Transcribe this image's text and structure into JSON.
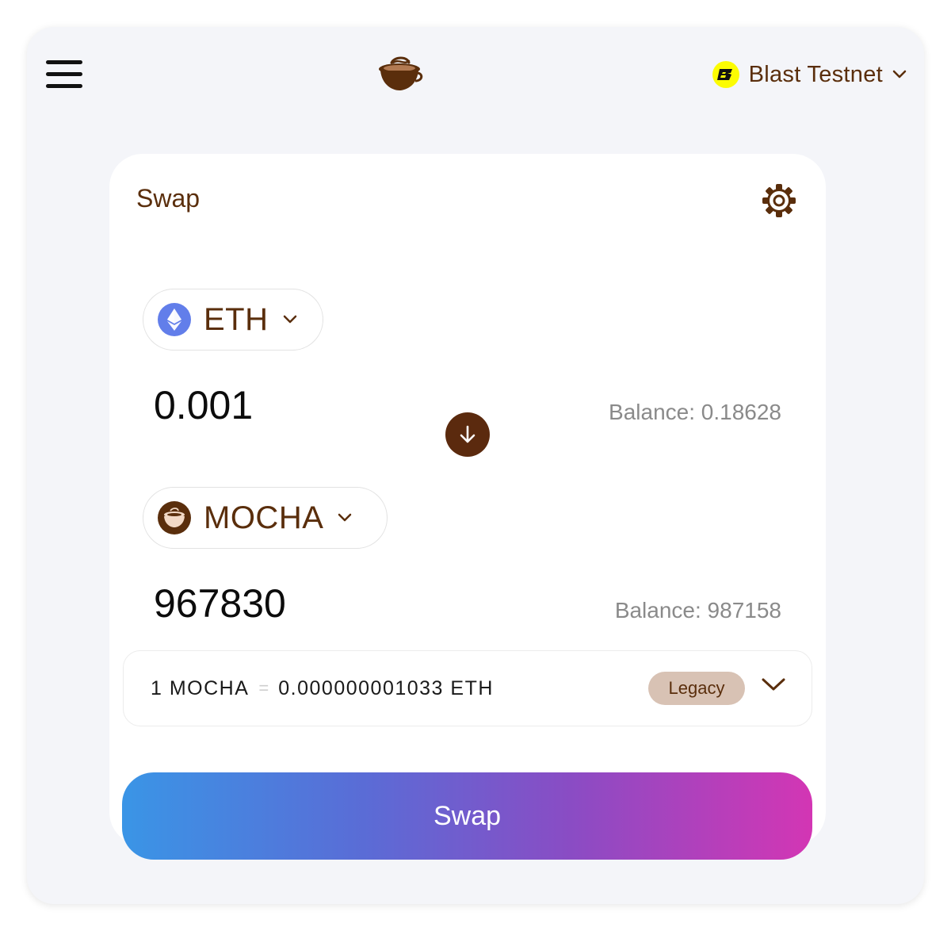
{
  "header": {
    "menu_icon": "hamburger-menu-icon",
    "logo_icon": "coffee-cup-logo-icon",
    "network": {
      "label": "Blast Testnet",
      "icon": "blast-network-icon",
      "icon_letter": "B",
      "icon_color": "#fcfc03"
    }
  },
  "swap": {
    "title": "Swap",
    "settings_icon": "gear-icon",
    "from": {
      "token": "ETH",
      "amount": "0.001",
      "balance": "Balance: 0.18628"
    },
    "to": {
      "token": "MOCHA",
      "amount": "967830",
      "balance": "Balance: 987158"
    },
    "rate": {
      "left": "1 MOCHA",
      "eq": "=",
      "right": "0.000000001033 ETH",
      "badge": "Legacy"
    },
    "submit_label": "Swap"
  },
  "colors": {
    "brand_brown": "#5a2e0c",
    "eth_blue": "#627eea",
    "legacy_badge": "#d8c2b4",
    "gradient_start": "#3a95e6",
    "gradient_end": "#d336b4"
  }
}
